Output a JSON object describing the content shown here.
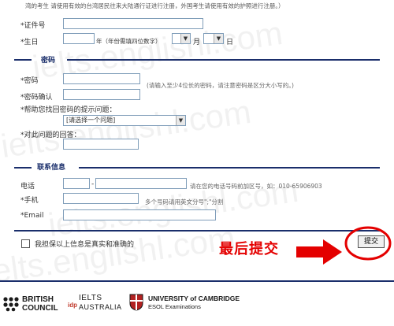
{
  "notice": "湾的考生 请使用有效的台湾居民往来大陆通行证进行注册，外国考生请使用有效的护照进行注册。）",
  "fields": {
    "id_number_label": "*证件号",
    "birthday_label": "*生日",
    "year_label": "年（年份需填四位数字）",
    "month_label": "月",
    "day_label": "日"
  },
  "password_section": {
    "title": "密码",
    "password_label": "*密码",
    "password_hint": "(请输入至少4位长的密码，请注意密码是区分大小写的。)",
    "confirm_label": "*密码确认",
    "question_label": "*帮助您找回密码的提示问题：",
    "question_select": "[请选择一个问题]",
    "answer_label": "*对此问题的回答："
  },
  "contact_section": {
    "title": "联系信息",
    "phone_label": "电话",
    "phone_dash": "-",
    "phone_hint": "请在您的电话号码前加区号，如：010-65906903",
    "mobile_label": "*手机",
    "mobile_hint": "多个号码请用英文分号\";\"分割",
    "email_label": "*Email"
  },
  "agreement": "我担保以上信息是真实和准确的",
  "submit_label": "提交",
  "annotation": "最后提交",
  "footer": {
    "british_council": [
      "BRITISH",
      "COUNCIL"
    ],
    "ielts_top": "IELTS",
    "ielts_bottom": "AUSTRALIA",
    "ielts_idp": "idp",
    "cambridge_top": "UNIVERSITY of CAMBRIDGE",
    "cambridge_bottom": "ESOL Examinations"
  },
  "watermark": "ielts.englishl.com",
  "colors": {
    "accent": "#1a2e6b",
    "annotation": "#e40000"
  }
}
